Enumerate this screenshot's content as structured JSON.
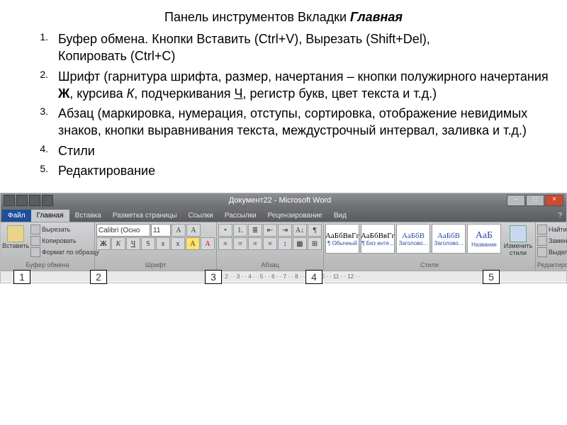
{
  "title": {
    "prefix": "Панель инструментов Вкладки ",
    "emph": "Главная"
  },
  "list": {
    "i1a": "Буфер обмена. Кнопки Вставить (Ctrl+V), Вырезать (Shift+Del),",
    "i1b": "Копировать (Ctrl+C)",
    "i2a": "Шрифт  (гарнитура шрифта, размер, начертания – кнопки полужирного начертания ",
    "i2b": "Ж",
    "i2c": ", курсива ",
    "i2d": "К",
    "i2e": ", подчеркивания ",
    "i2f": "Ч",
    "i2g": ", регистр букв, цвет текста и т.д.)",
    "i3": "Абзац (маркировка, нумерация, отступы, сортировка, отображение невидимых знаков, кнопки выравнивания текста, междустрочный интервал, заливка и т.д.)",
    "i4": "Стили",
    "i5": "Редактирование"
  },
  "ribbon": {
    "doc_title": "Документ22 - Microsoft Word",
    "tabs": {
      "file": "Файл",
      "home": "Главная",
      "insert": "Вставка",
      "layout": "Разметка страницы",
      "refs": "Ссылки",
      "mail": "Рассылки",
      "review": "Рецензирование",
      "view": "Вид"
    },
    "clipboard": {
      "cut": "Вырезать",
      "copy": "Копировать",
      "paste": "Вставить",
      "format": "Формат по образцу",
      "label": "Буфер обмена"
    },
    "font": {
      "family": "Calibri (Осно",
      "size": "11",
      "bold": "Ж",
      "ital": "К",
      "und": "Ч",
      "strike": "abc",
      "label": "Шрифт"
    },
    "para": {
      "label": "Абзац"
    },
    "styles": {
      "sample": "АаБбВвГг",
      "sample_h": "АаБбВ",
      "sample_t": "АаБ",
      "s1": "¶ Обычный",
      "s2": "¶ Без инте...",
      "s3": "Заголово...",
      "s4": "Заголово...",
      "s5": "Название",
      "change": "Изменить стили",
      "label": "Стили"
    },
    "editing": {
      "find": "Найти",
      "replace": "Заменить",
      "select": "Выделить",
      "label": "Редактирование"
    }
  },
  "numboxes": {
    "n1": "1",
    "n2": "2",
    "n3": "3",
    "n4": "4",
    "n5": "5"
  }
}
